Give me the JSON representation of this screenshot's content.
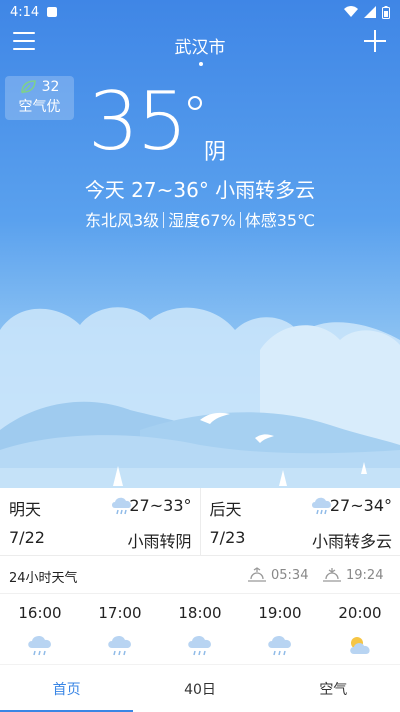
{
  "status_bar": {
    "time": "4:14"
  },
  "header": {
    "city": "武汉市"
  },
  "air_quality": {
    "value": "32",
    "label": "空气优"
  },
  "current": {
    "temperature": "35",
    "condition": "阴",
    "today_summary": "今天 27~36° 小雨转多云",
    "wind": "东北风3级",
    "humidity": "湿度67%",
    "feels_like": "体感35℃"
  },
  "daily": [
    {
      "name": "明天",
      "range": "27~33°",
      "date": "7/22",
      "condition": "小雨转阴",
      "icon": "light-rain-icon"
    },
    {
      "name": "后天",
      "range": "27~34°",
      "date": "7/23",
      "condition": "小雨转多云",
      "icon": "light-rain-icon"
    }
  ],
  "hourly": {
    "title": "24小时天气",
    "sunrise": "05:34",
    "sunset": "19:24",
    "hours": [
      {
        "time": "16:00",
        "icon": "rain-cloud-icon"
      },
      {
        "time": "17:00",
        "icon": "rain-cloud-icon"
      },
      {
        "time": "18:00",
        "icon": "rain-cloud-icon"
      },
      {
        "time": "19:00",
        "icon": "rain-cloud-icon"
      },
      {
        "time": "20:00",
        "icon": "partly-cloudy-icon"
      }
    ]
  },
  "tabs": [
    {
      "label": "首页",
      "active": true
    },
    {
      "label": "40日",
      "active": false
    },
    {
      "label": "空气",
      "active": false
    }
  ],
  "colors": {
    "accent": "#3a86e5",
    "sky_top": "#3f86e6",
    "cloud_icon": "#b8d4f2"
  }
}
